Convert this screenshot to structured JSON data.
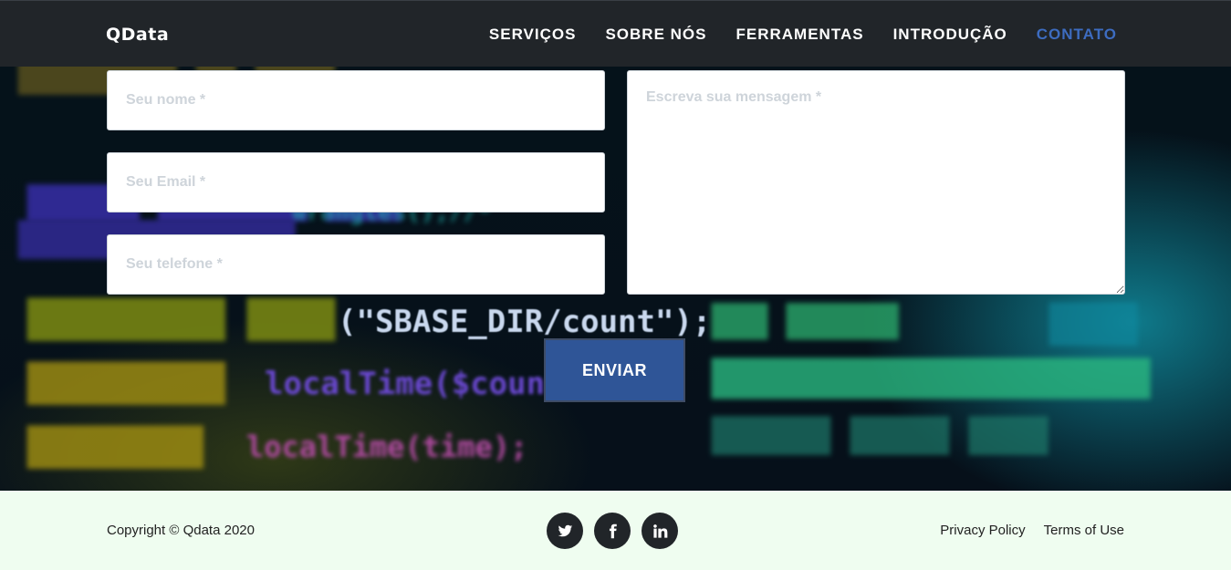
{
  "brand": "QData",
  "nav": {
    "items": [
      {
        "label": "SERVIÇOS"
      },
      {
        "label": "SOBRE NÓS"
      },
      {
        "label": "FERRAMENTAS"
      },
      {
        "label": "INTRODUÇÃO"
      },
      {
        "label": "CONTATO",
        "active": true
      }
    ],
    "active_color": "#3d6cc0"
  },
  "form": {
    "name_placeholder": "Seu nome *",
    "email_placeholder": "Seu Email *",
    "phone_placeholder": "Seu telefone *",
    "message_placeholder": "Escreva sua mensagem *",
    "submit_label": "ENVIAR",
    "submit_color": "#2f5597"
  },
  "background_code": {
    "line_1": "(\"SBASE_DIR/count\");",
    "line_2": "localTime($countfi",
    "line_3": "localTime(time);"
  },
  "footer": {
    "copyright": "Copyright © Qdata 2020",
    "social": [
      "twitter-icon",
      "facebook-icon",
      "linkedin-icon"
    ],
    "links": [
      {
        "label": "Privacy Policy"
      },
      {
        "label": "Terms of Use"
      }
    ],
    "background": "#effdf0"
  }
}
